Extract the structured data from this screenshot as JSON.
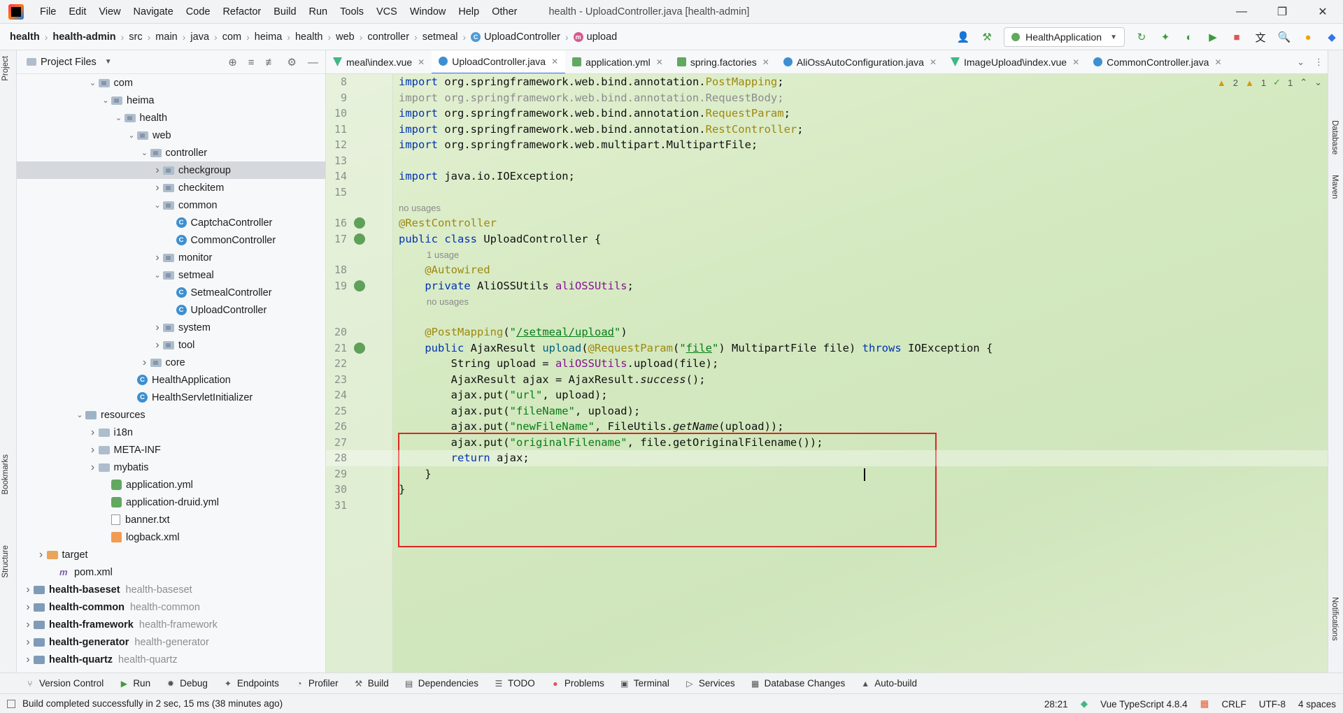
{
  "menubar": {
    "items": [
      "File",
      "Edit",
      "View",
      "Navigate",
      "Code",
      "Refactor",
      "Build",
      "Run",
      "Tools",
      "VCS",
      "Window",
      "Help",
      "Other"
    ],
    "window_title": "health - UploadController.java [health-admin]"
  },
  "breadcrumb": [
    "health",
    "health-admin",
    "src",
    "main",
    "java",
    "com",
    "heima",
    "health",
    "web",
    "controller",
    "setmeal",
    "UploadController",
    "upload"
  ],
  "run_config": "HealthApplication",
  "project_panel": {
    "title": "Project Files"
  },
  "tree": [
    {
      "label": "com",
      "indent": 5,
      "chev": "v",
      "icon": "pkg"
    },
    {
      "label": "heima",
      "indent": 6,
      "chev": "v",
      "icon": "pkg"
    },
    {
      "label": "health",
      "indent": 7,
      "chev": "v",
      "icon": "pkg"
    },
    {
      "label": "web",
      "indent": 8,
      "chev": "v",
      "icon": "pkg"
    },
    {
      "label": "controller",
      "indent": 9,
      "chev": "v",
      "icon": "pkg"
    },
    {
      "label": "checkgroup",
      "indent": 10,
      "chev": ">",
      "icon": "pkg",
      "selected": true
    },
    {
      "label": "checkitem",
      "indent": 10,
      "chev": ">",
      "icon": "pkg"
    },
    {
      "label": "common",
      "indent": 10,
      "chev": "v",
      "icon": "pkg"
    },
    {
      "label": "CaptchaController",
      "indent": 11,
      "chev": "",
      "icon": "class"
    },
    {
      "label": "CommonController",
      "indent": 11,
      "chev": "",
      "icon": "class"
    },
    {
      "label": "monitor",
      "indent": 10,
      "chev": ">",
      "icon": "pkg"
    },
    {
      "label": "setmeal",
      "indent": 10,
      "chev": "v",
      "icon": "pkg"
    },
    {
      "label": "SetmealController",
      "indent": 11,
      "chev": "",
      "icon": "class"
    },
    {
      "label": "UploadController",
      "indent": 11,
      "chev": "",
      "icon": "class"
    },
    {
      "label": "system",
      "indent": 10,
      "chev": ">",
      "icon": "pkg"
    },
    {
      "label": "tool",
      "indent": 10,
      "chev": ">",
      "icon": "pkg"
    },
    {
      "label": "core",
      "indent": 9,
      "chev": ">",
      "icon": "pkg"
    },
    {
      "label": "HealthApplication",
      "indent": 8,
      "chev": "",
      "icon": "class"
    },
    {
      "label": "HealthServletInitializer",
      "indent": 8,
      "chev": "",
      "icon": "class"
    },
    {
      "label": "resources",
      "indent": 4,
      "chev": "v",
      "icon": "res"
    },
    {
      "label": "i18n",
      "indent": 5,
      "chev": ">",
      "icon": "folder"
    },
    {
      "label": "META-INF",
      "indent": 5,
      "chev": ">",
      "icon": "folder"
    },
    {
      "label": "mybatis",
      "indent": 5,
      "chev": ">",
      "icon": "folder"
    },
    {
      "label": "application.yml",
      "indent": 6,
      "chev": "",
      "icon": "yml"
    },
    {
      "label": "application-druid.yml",
      "indent": 6,
      "chev": "",
      "icon": "yml"
    },
    {
      "label": "banner.txt",
      "indent": 6,
      "chev": "",
      "icon": "txt"
    },
    {
      "label": "logback.xml",
      "indent": 6,
      "chev": "",
      "icon": "xml"
    },
    {
      "label": "target",
      "indent": 1,
      "chev": ">",
      "icon": "orange"
    },
    {
      "label": "pom.xml",
      "indent": 2,
      "chev": "",
      "icon": "pom"
    },
    {
      "label": "health-baseset",
      "sub": "health-baseset",
      "indent": 0,
      "chev": ">",
      "icon": "mod"
    },
    {
      "label": "health-common",
      "sub": "health-common",
      "indent": 0,
      "chev": ">",
      "icon": "mod"
    },
    {
      "label": "health-framework",
      "sub": "health-framework",
      "indent": 0,
      "chev": ">",
      "icon": "mod"
    },
    {
      "label": "health-generator",
      "sub": "health-generator",
      "indent": 0,
      "chev": ">",
      "icon": "mod"
    },
    {
      "label": "health-quartz",
      "sub": "health-quartz",
      "indent": 0,
      "chev": ">",
      "icon": "mod"
    }
  ],
  "tabs": [
    {
      "label": "meal\\index.vue",
      "icon": "vue"
    },
    {
      "label": "UploadController.java",
      "icon": "class",
      "active": true
    },
    {
      "label": "application.yml",
      "icon": "yml"
    },
    {
      "label": "spring.factories",
      "icon": "yml"
    },
    {
      "label": "AliOssAutoConfiguration.java",
      "icon": "class"
    },
    {
      "label": "ImageUpload\\index.vue",
      "icon": "vue"
    },
    {
      "label": "CommonController.java",
      "icon": "class"
    }
  ],
  "inspections": {
    "warnings": "2",
    "weak": "1",
    "ok": "1"
  },
  "code_lines": [
    {
      "n": "8",
      "html": "<span class=\"kw\">import</span> org.springframework.web.bind.annotation.<span class=\"ann\">PostMapping</span>;"
    },
    {
      "n": "9",
      "html": "<span class=\"faded\">import org.springframework.web.bind.annotation.RequestBody;</span>"
    },
    {
      "n": "10",
      "html": "<span class=\"kw\">import</span> org.springframework.web.bind.annotation.<span class=\"ann\">RequestParam</span>;"
    },
    {
      "n": "11",
      "html": "<span class=\"kw\">import</span> org.springframework.web.bind.annotation.<span class=\"ann\">RestController</span>;"
    },
    {
      "n": "12",
      "html": "<span class=\"kw\">import</span> org.springframework.web.multipart.MultipartFile;"
    },
    {
      "n": "13",
      "html": ""
    },
    {
      "n": "14",
      "html": "<span class=\"kw\">import</span> java.io.IOException;"
    },
    {
      "n": "15",
      "html": ""
    },
    {
      "hint": "no usages"
    },
    {
      "n": "16",
      "html": "<span class=\"ann\">@RestController</span>",
      "gicon": true
    },
    {
      "n": "17",
      "html": "<span class=\"kw\">public class</span> UploadController {",
      "gicon": true
    },
    {
      "hint": "1 usage",
      "indent": 4
    },
    {
      "n": "18",
      "html": "    <span class=\"ann\">@Autowired</span>"
    },
    {
      "n": "19",
      "html": "    <span class=\"kw\">private</span> AliOSSUtils <span class=\"fld\">aliOSSUtils</span>;",
      "gicon": true
    },
    {
      "hint": "no usages",
      "indent": 4
    },
    {
      "hint": "",
      "indent": 4
    },
    {
      "n": "20",
      "html": "    <span class=\"ann\">@PostMapping</span>(<span class=\"str\">\"<u>/setmeal/upload</u>\"</span>)"
    },
    {
      "n": "21",
      "html": "    <span class=\"kw\">public</span> AjaxResult <span style=\"color:#00627a\">upload</span>(<span class=\"ann\">@RequestParam</span>(<span class=\"str\">\"<u>file</u>\"</span>) MultipartFile file) <span class=\"kw\">throws</span> IOException {",
      "gicon": true
    },
    {
      "n": "22",
      "html": "        String upload = <span class=\"fld\">aliOSSUtils</span>.upload(file);"
    },
    {
      "n": "23",
      "html": "        AjaxResult ajax = AjaxResult.<span class=\"it\">success</span>();"
    },
    {
      "n": "24",
      "html": "        ajax.put(<span class=\"str\">\"url\"</span>, upload);"
    },
    {
      "n": "25",
      "html": "        ajax.put(<span class=\"str\">\"fileName\"</span>, upload);"
    },
    {
      "n": "26",
      "html": "        ajax.put(<span class=\"str\">\"newFileName\"</span>, FileUtils.<span class=\"it\">getName</span>(upload));"
    },
    {
      "n": "27",
      "html": "        ajax.put(<span class=\"str\">\"originalFilename\"</span>, file.getOriginalFilename());"
    },
    {
      "n": "28",
      "html": "        <span class=\"kw\">return</span> ajax;",
      "current": true
    },
    {
      "n": "29",
      "html": "    }"
    },
    {
      "n": "30",
      "html": "}"
    },
    {
      "n": "31",
      "html": ""
    }
  ],
  "left_stripe": [
    "Project",
    "Bookmarks",
    "Structure"
  ],
  "right_stripe": [
    "Database",
    "Maven",
    "Notifications"
  ],
  "toolwindows": [
    "Version Control",
    "Run",
    "Debug",
    "Endpoints",
    "Profiler",
    "Build",
    "Dependencies",
    "TODO",
    "Problems",
    "Terminal",
    "Services",
    "Database Changes",
    "Auto-build"
  ],
  "status": {
    "message": "Build completed successfully in 2 sec, 15 ms (38 minutes ago)",
    "position": "28:21",
    "language": "Vue TypeScript 4.8.4",
    "line_sep": "CRLF",
    "encoding": "UTF-8",
    "indent": "4 spaces"
  }
}
